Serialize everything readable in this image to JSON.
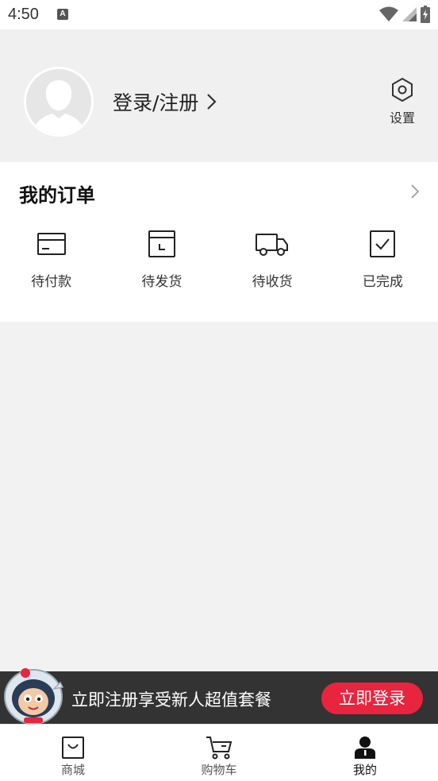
{
  "status_bar": {
    "time": "4:50",
    "notification_badge": "A"
  },
  "profile": {
    "login_text": "登录/注册",
    "settings_label": "设置"
  },
  "orders": {
    "title": "我的订单",
    "items": [
      {
        "label": "待付款",
        "icon": "card-icon"
      },
      {
        "label": "待发货",
        "icon": "box-icon"
      },
      {
        "label": "待收货",
        "icon": "truck-icon"
      },
      {
        "label": "已完成",
        "icon": "check-box-icon"
      }
    ]
  },
  "promo": {
    "text": "立即注册享受新人超值套餐",
    "button": "立即登录",
    "button_color": "#e8243e"
  },
  "tabbar": {
    "items": [
      {
        "label": "商城",
        "icon": "shop-bag-icon",
        "active": false
      },
      {
        "label": "购物车",
        "icon": "cart-icon",
        "active": false
      },
      {
        "label": "我的",
        "icon": "person-icon",
        "active": true
      }
    ]
  }
}
